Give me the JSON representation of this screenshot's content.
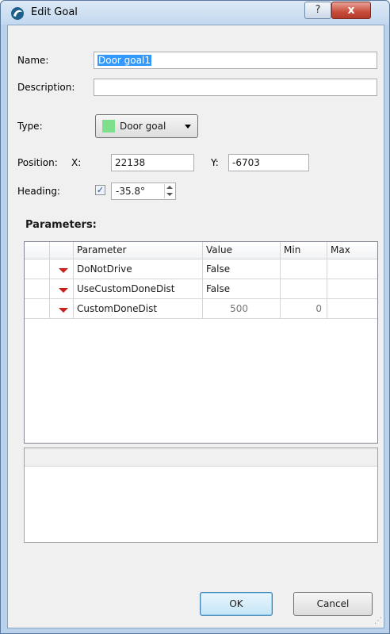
{
  "window": {
    "title": "Edit Goal",
    "help_glyph": "?",
    "close_glyph": "x"
  },
  "form": {
    "name_label": "Name:",
    "name_value": "Door goal1",
    "description_label": "Description:",
    "description_value": "",
    "type_label": "Type:",
    "type_value": "Door goal",
    "type_color": "#7ee08a",
    "position_label": "Position:",
    "x_label": "X:",
    "x_value": "22138",
    "y_label": "Y:",
    "y_value": "-6703",
    "heading_label": "Heading:",
    "heading_checked": "✓",
    "heading_value": "-35.8°"
  },
  "parameters": {
    "title": "Parameters:",
    "columns": [
      "Parameter",
      "Value",
      "Min",
      "Max"
    ],
    "rows": [
      {
        "name": "DoNotDrive",
        "value": "False",
        "min": "",
        "max": ""
      },
      {
        "name": "UseCustomDoneDist",
        "value": "False",
        "min": "",
        "max": ""
      },
      {
        "name": "CustomDoneDist",
        "value": "500",
        "min": "0",
        "max": ""
      }
    ]
  },
  "buttons": {
    "ok": "OK",
    "cancel": "Cancel"
  },
  "colors": {
    "accent": "#3399ff",
    "close": "#c74c3a",
    "row_arrow": "#c8201c"
  }
}
